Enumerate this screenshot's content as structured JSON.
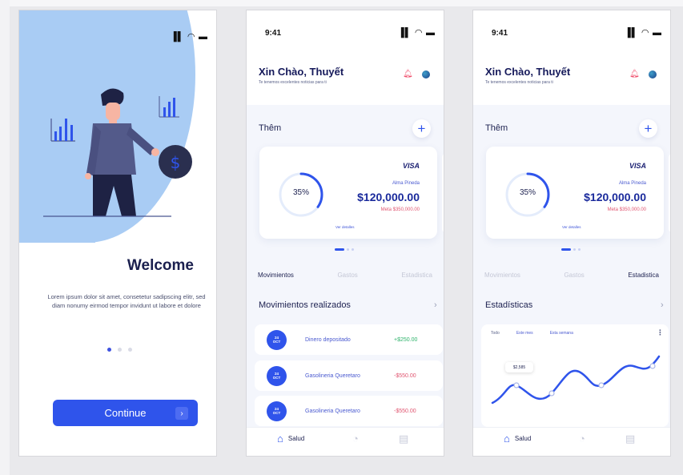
{
  "onboarding": {
    "status_icons": "▐▌ ◠ ▬",
    "title": "Welcome",
    "body": "Lorem ipsum dolor sit amet, consetetur sadipscing elitr, sed diam nonumy eirmod tempor invidunt ut labore et dolore",
    "continue_label": "Continue",
    "continue_arrow": "›",
    "page_dots": 3,
    "active_dot": 0
  },
  "home": {
    "time": "9:41",
    "status_icons": "▐▌ ◠ ▬",
    "greeting": "Xin Chào, Thuyết",
    "greeting_sub": "Te tenemos excelentes noticias para ti",
    "section_title": "Thêm",
    "plus": "+",
    "card": {
      "brand": "VISA",
      "holder": "Alma Pineda",
      "amount": "$120,000.00",
      "goal": "Meta $350,000.00",
      "progress_label": "35%",
      "progress": 0.35,
      "details_link": "Ver detalles"
    },
    "tabs": [
      "Movimientos",
      "Gastos",
      "Estadistica"
    ],
    "list_title": "Movimientos realizados",
    "chevron": "›",
    "transactions": [
      {
        "day": "24",
        "month": "OCT",
        "label": "Dinero depositado",
        "amount": "+$250.00",
        "type": "pos"
      },
      {
        "day": "24",
        "month": "OCT",
        "label": "Gasolineria Queretaro",
        "amount": "-$550.00",
        "type": "neg"
      },
      {
        "day": "24",
        "month": "OCT",
        "label": "Gasolineria Queretaro",
        "amount": "-$550.00",
        "type": "neg"
      }
    ],
    "nav": {
      "home_label": "Salud"
    }
  },
  "stats": {
    "time": "9:41",
    "status_icons": "▐▌ ◠ ▬",
    "greeting": "Xin Chào, Thuyết",
    "greeting_sub": "Te tenemos excelentes noticias para ti",
    "section_title": "Thêm",
    "plus": "+",
    "card": {
      "brand": "VISA",
      "holder": "Alma Pineda",
      "amount": "$120,000.00",
      "goal": "Meta $350,000.00",
      "progress_label": "35%",
      "progress": 0.35,
      "details_link": "Ver detalles"
    },
    "tabs": [
      "Movimientos",
      "Gastos",
      "Estadistica"
    ],
    "list_title": "Estadísticas",
    "chevron": "›",
    "chart_tabs": [
      "Todo",
      "Este mes",
      "Esta semana"
    ],
    "kebab": "⋮",
    "tooltip": "$2,585",
    "nav": {
      "home_label": "Salud"
    }
  },
  "colors": {
    "primary": "#2f54eb",
    "navy": "#1d2150",
    "positive": "#2fb36b",
    "negative": "#e05570",
    "blob": "#a9ccf4"
  }
}
